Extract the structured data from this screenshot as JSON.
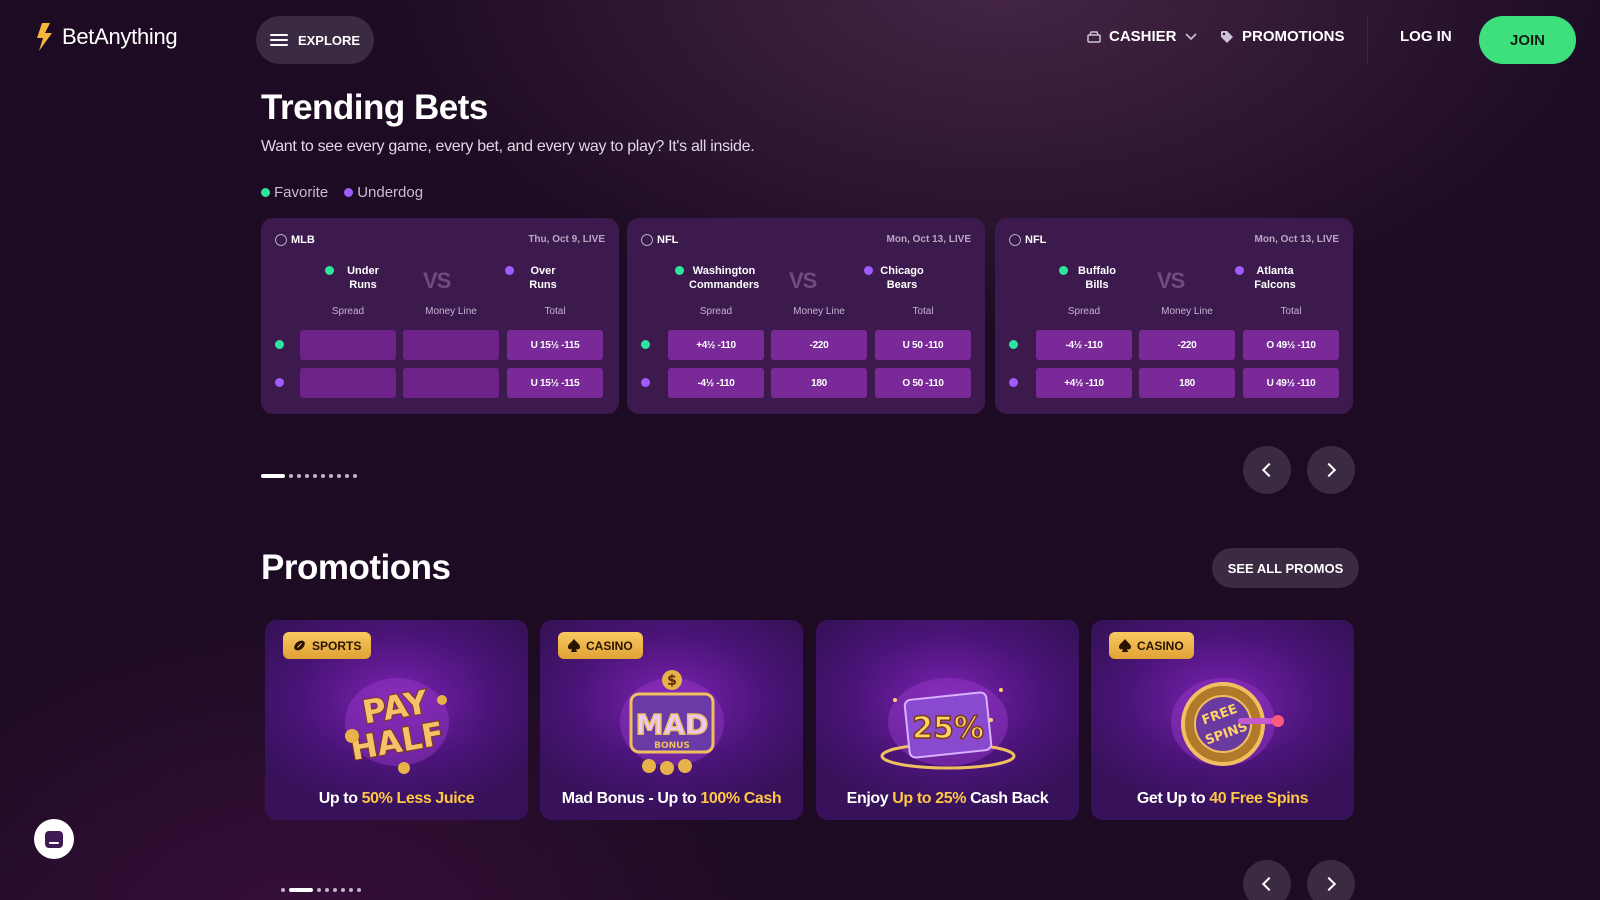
{
  "header": {
    "brand": "BetAnything",
    "explore_label": "EXPLORE",
    "cashier_label": "CASHIER",
    "promotions_label": "PROMOTIONS",
    "login_label": "LOG IN",
    "join_label": "JOIN"
  },
  "trending": {
    "title": "Trending Bets",
    "subtitle": "Want to see every game, every bet, and every way to play? It's all inside.",
    "legend": {
      "favorite": "Favorite",
      "underdog": "Underdog"
    },
    "vs_label": "VS",
    "col_headers": [
      "Spread",
      "Money Line",
      "Total"
    ],
    "cards": [
      {
        "league": "MLB",
        "when": "Thu, Oct 9, LIVE",
        "team_fav": "Under\nRuns",
        "team_dog": "Over\nRuns",
        "fav_row": [
          "",
          "",
          "U 15½ -115"
        ],
        "dog_row": [
          "",
          "",
          "U 15½ -115"
        ]
      },
      {
        "league": "NFL",
        "when": "Mon, Oct 13, LIVE",
        "team_fav": "Washington\nCommanders",
        "team_dog": "Chicago\nBears",
        "fav_row": [
          "+4½ -110",
          "-220",
          "U 50 -110"
        ],
        "dog_row": [
          "-4½ -110",
          "180",
          "O 50 -110"
        ]
      },
      {
        "league": "NFL",
        "when": "Mon, Oct 13, LIVE",
        "team_fav": "Buffalo\nBills",
        "team_dog": "Atlanta\nFalcons",
        "fav_row": [
          "-4½ -110",
          "-220",
          "O 49½ -110"
        ],
        "dog_row": [
          "+4½ -110",
          "180",
          "U 49½ -110"
        ]
      }
    ]
  },
  "promotions": {
    "title": "Promotions",
    "see_all_label": "SEE ALL PROMOS",
    "cards": [
      {
        "badge": "SPORTS",
        "art": "PAY HALF",
        "text_pre": "Up to ",
        "text_hl": "50% Less Juice",
        "text_post": ""
      },
      {
        "badge": "CASINO",
        "art": "MAD BONUS",
        "text_pre": "Mad Bonus - Up to ",
        "text_hl": "100% Cash",
        "text_post": ""
      },
      {
        "badge": "",
        "art": "25%",
        "text_pre": "Enjoy ",
        "text_hl": "Up to 25%",
        "text_post": " Cash Back"
      },
      {
        "badge": "CASINO",
        "art": "FREE SPINS",
        "text_pre": "Get Up to ",
        "text_hl": "40 Free Spins",
        "text_post": ""
      }
    ]
  },
  "icons": {
    "logo": "bolt-logo-icon",
    "explore": "hamburger-icon",
    "cashier": "cashier-icon",
    "promotions": "tag-icon",
    "chat": "chat-icon"
  },
  "colors": {
    "accent": "#3ee07d",
    "favorite": "#2ee59d",
    "underdog": "#a15cff",
    "highlight": "#ffc646",
    "background": "#1c0b22"
  },
  "pagers": {
    "trending": {
      "count": 10,
      "active": 0
    },
    "promotions": {
      "count": 8,
      "active": 1
    }
  }
}
